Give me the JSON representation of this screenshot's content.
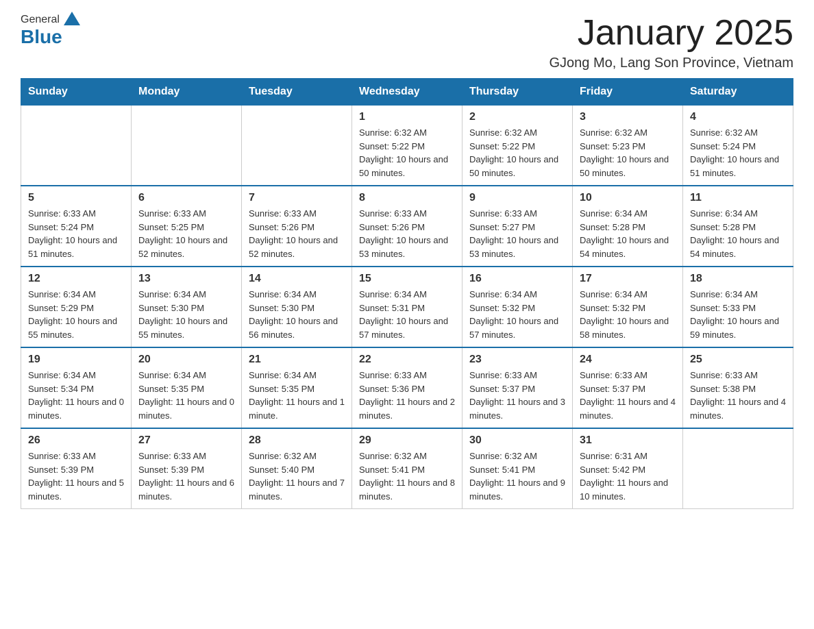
{
  "header": {
    "logo_general": "General",
    "logo_blue": "Blue",
    "title": "January 2025",
    "subtitle": "GJong Mo, Lang Son Province, Vietnam"
  },
  "days_of_week": [
    "Sunday",
    "Monday",
    "Tuesday",
    "Wednesday",
    "Thursday",
    "Friday",
    "Saturday"
  ],
  "weeks": [
    [
      {
        "day": "",
        "info": ""
      },
      {
        "day": "",
        "info": ""
      },
      {
        "day": "",
        "info": ""
      },
      {
        "day": "1",
        "info": "Sunrise: 6:32 AM\nSunset: 5:22 PM\nDaylight: 10 hours and 50 minutes."
      },
      {
        "day": "2",
        "info": "Sunrise: 6:32 AM\nSunset: 5:22 PM\nDaylight: 10 hours and 50 minutes."
      },
      {
        "day": "3",
        "info": "Sunrise: 6:32 AM\nSunset: 5:23 PM\nDaylight: 10 hours and 50 minutes."
      },
      {
        "day": "4",
        "info": "Sunrise: 6:32 AM\nSunset: 5:24 PM\nDaylight: 10 hours and 51 minutes."
      }
    ],
    [
      {
        "day": "5",
        "info": "Sunrise: 6:33 AM\nSunset: 5:24 PM\nDaylight: 10 hours and 51 minutes."
      },
      {
        "day": "6",
        "info": "Sunrise: 6:33 AM\nSunset: 5:25 PM\nDaylight: 10 hours and 52 minutes."
      },
      {
        "day": "7",
        "info": "Sunrise: 6:33 AM\nSunset: 5:26 PM\nDaylight: 10 hours and 52 minutes."
      },
      {
        "day": "8",
        "info": "Sunrise: 6:33 AM\nSunset: 5:26 PM\nDaylight: 10 hours and 53 minutes."
      },
      {
        "day": "9",
        "info": "Sunrise: 6:33 AM\nSunset: 5:27 PM\nDaylight: 10 hours and 53 minutes."
      },
      {
        "day": "10",
        "info": "Sunrise: 6:34 AM\nSunset: 5:28 PM\nDaylight: 10 hours and 54 minutes."
      },
      {
        "day": "11",
        "info": "Sunrise: 6:34 AM\nSunset: 5:28 PM\nDaylight: 10 hours and 54 minutes."
      }
    ],
    [
      {
        "day": "12",
        "info": "Sunrise: 6:34 AM\nSunset: 5:29 PM\nDaylight: 10 hours and 55 minutes."
      },
      {
        "day": "13",
        "info": "Sunrise: 6:34 AM\nSunset: 5:30 PM\nDaylight: 10 hours and 55 minutes."
      },
      {
        "day": "14",
        "info": "Sunrise: 6:34 AM\nSunset: 5:30 PM\nDaylight: 10 hours and 56 minutes."
      },
      {
        "day": "15",
        "info": "Sunrise: 6:34 AM\nSunset: 5:31 PM\nDaylight: 10 hours and 57 minutes."
      },
      {
        "day": "16",
        "info": "Sunrise: 6:34 AM\nSunset: 5:32 PM\nDaylight: 10 hours and 57 minutes."
      },
      {
        "day": "17",
        "info": "Sunrise: 6:34 AM\nSunset: 5:32 PM\nDaylight: 10 hours and 58 minutes."
      },
      {
        "day": "18",
        "info": "Sunrise: 6:34 AM\nSunset: 5:33 PM\nDaylight: 10 hours and 59 minutes."
      }
    ],
    [
      {
        "day": "19",
        "info": "Sunrise: 6:34 AM\nSunset: 5:34 PM\nDaylight: 11 hours and 0 minutes."
      },
      {
        "day": "20",
        "info": "Sunrise: 6:34 AM\nSunset: 5:35 PM\nDaylight: 11 hours and 0 minutes."
      },
      {
        "day": "21",
        "info": "Sunrise: 6:34 AM\nSunset: 5:35 PM\nDaylight: 11 hours and 1 minute."
      },
      {
        "day": "22",
        "info": "Sunrise: 6:33 AM\nSunset: 5:36 PM\nDaylight: 11 hours and 2 minutes."
      },
      {
        "day": "23",
        "info": "Sunrise: 6:33 AM\nSunset: 5:37 PM\nDaylight: 11 hours and 3 minutes."
      },
      {
        "day": "24",
        "info": "Sunrise: 6:33 AM\nSunset: 5:37 PM\nDaylight: 11 hours and 4 minutes."
      },
      {
        "day": "25",
        "info": "Sunrise: 6:33 AM\nSunset: 5:38 PM\nDaylight: 11 hours and 4 minutes."
      }
    ],
    [
      {
        "day": "26",
        "info": "Sunrise: 6:33 AM\nSunset: 5:39 PM\nDaylight: 11 hours and 5 minutes."
      },
      {
        "day": "27",
        "info": "Sunrise: 6:33 AM\nSunset: 5:39 PM\nDaylight: 11 hours and 6 minutes."
      },
      {
        "day": "28",
        "info": "Sunrise: 6:32 AM\nSunset: 5:40 PM\nDaylight: 11 hours and 7 minutes."
      },
      {
        "day": "29",
        "info": "Sunrise: 6:32 AM\nSunset: 5:41 PM\nDaylight: 11 hours and 8 minutes."
      },
      {
        "day": "30",
        "info": "Sunrise: 6:32 AM\nSunset: 5:41 PM\nDaylight: 11 hours and 9 minutes."
      },
      {
        "day": "31",
        "info": "Sunrise: 6:31 AM\nSunset: 5:42 PM\nDaylight: 11 hours and 10 minutes."
      },
      {
        "day": "",
        "info": ""
      }
    ]
  ]
}
